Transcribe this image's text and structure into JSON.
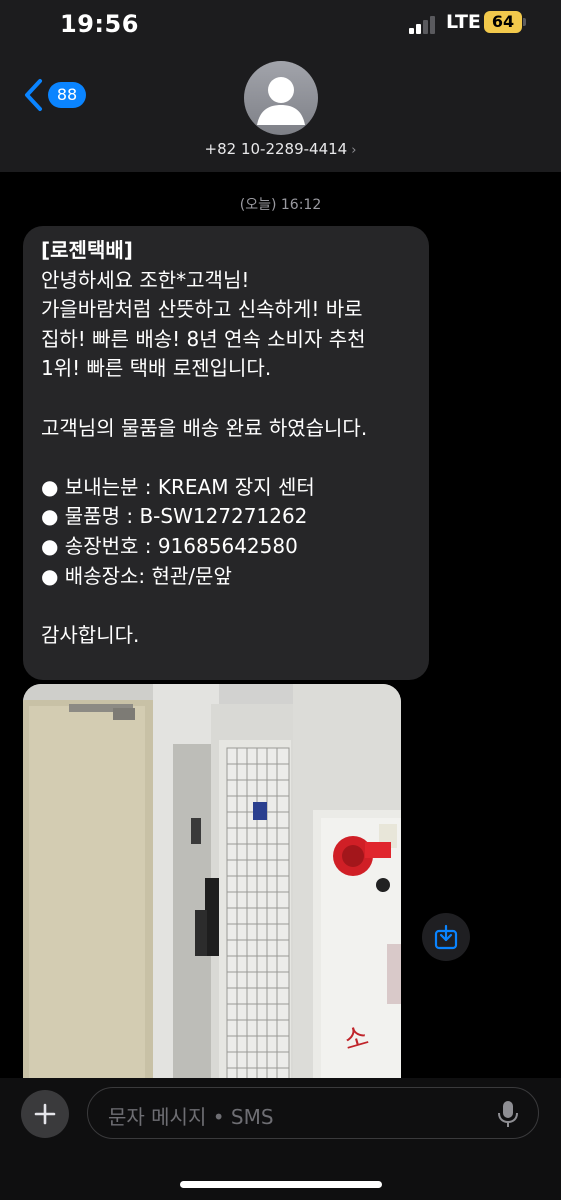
{
  "status_bar": {
    "time": "19:56",
    "network": "LTE",
    "battery": "64"
  },
  "nav": {
    "back_count": "88",
    "contact": "+82 10-2289-4414",
    "contact_chevron": "›"
  },
  "timestamp": "(오늘) 16:12",
  "message": {
    "lines": [
      "[로젠택배]",
      "안녕하세요 조한*고객님!",
      "가을바람처럼 산뜻하고 신속하게! 바로",
      "집하! 빠른 배송! 8년 연속 소비자 추천",
      "1위! 빠른 택배 로젠입니다.",
      "",
      "고객님의 물품을 배송 완료 하였습니다.",
      "",
      "● 보내는분 : KREAM 장지 센터",
      "● 물품명 : B-SW127271262",
      "● 송장번호 : 91685642580",
      "● 배송장소: 현관/문앞",
      "",
      "감사합니다."
    ]
  },
  "photo": {
    "sign_text": "소"
  },
  "composer": {
    "placeholder": "문자 메시지 • SMS"
  },
  "icons": [
    "back-chevron-icon",
    "person-icon",
    "save-to-photos-icon",
    "plus-icon",
    "microphone-icon"
  ],
  "colors": {
    "accent": "#0a84ff",
    "bubble": "#262628",
    "battery": "#f2c94c",
    "background": "#000000"
  }
}
